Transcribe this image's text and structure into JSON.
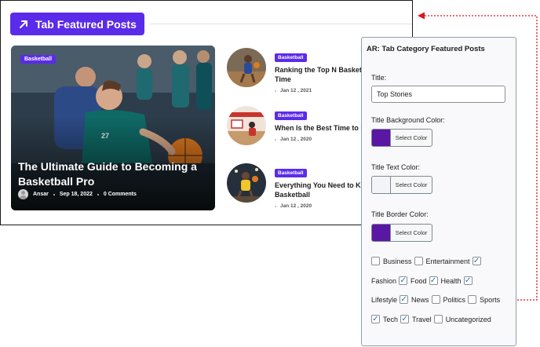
{
  "preview": {
    "widget_title": "Tab Featured Posts",
    "feature": {
      "category": "Basketball",
      "title": "The Ultimate Guide to Becoming a Basketball Pro",
      "author": "Ansar",
      "date": "Sep 18, 2022",
      "comments": "0 Comments"
    },
    "posts": [
      {
        "category": "Basketball",
        "title": "Ranking the Top N Basket",
        "title_line2": "Time",
        "date": "Jan 12 , 2021"
      },
      {
        "category": "Basketball",
        "title": "When Is the Best Time to I",
        "title_line2": "",
        "date": "Jan 12 , 2020"
      },
      {
        "category": "Basketball",
        "title": "Everything You Need to Kr",
        "title_line2": "Basketball",
        "date": "Jan 12 , 2020"
      }
    ]
  },
  "panel": {
    "heading": "AR: Tab Category Featured Posts",
    "title_label": "Title:",
    "title_value": "Top Stories",
    "bg_color_label": "Title Background Color:",
    "text_color_label": "Title Text Color:",
    "border_color_label": "Title Border Color:",
    "select_color_label": "Select Color",
    "colors": {
      "background": "#5a17a3",
      "text": "#f2f4f8",
      "border": "#5a17a3",
      "accent": "#5b2bea",
      "connector": "#d9161c"
    },
    "categories": [
      {
        "label": "Business",
        "checked": false
      },
      {
        "label": "Entertainment",
        "checked": false
      },
      {
        "label": "Fashion",
        "checked": true
      },
      {
        "label": "Food",
        "checked": true
      },
      {
        "label": "Health",
        "checked": true
      },
      {
        "label": "Lifestyle",
        "checked": true
      },
      {
        "label": "News",
        "checked": true
      },
      {
        "label": "Politics",
        "checked": false
      },
      {
        "label": "Sports",
        "checked": false
      },
      {
        "label": "Tech",
        "checked": true
      },
      {
        "label": "Travel",
        "checked": true
      },
      {
        "label": "Uncategorized",
        "checked": false
      }
    ]
  },
  "icons": {
    "title_arrow": "arrow-up-right-icon"
  }
}
